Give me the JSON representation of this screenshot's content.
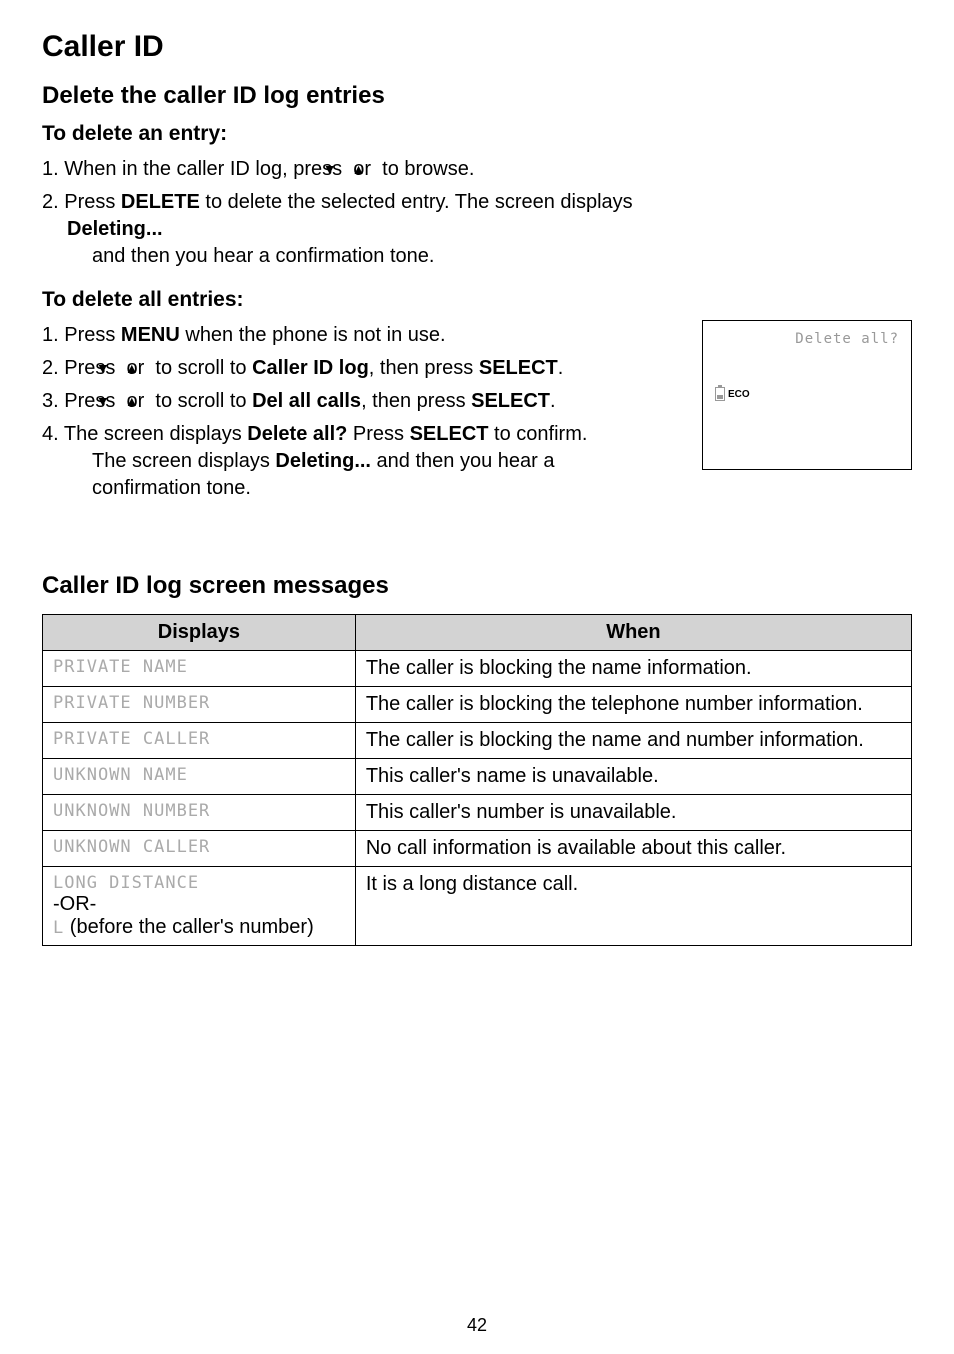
{
  "title": "Caller ID",
  "section1": {
    "heading": "Delete the caller ID log entries",
    "subheading_a": "To delete an entry:",
    "steps_a": {
      "s1_prefix": "1. When in the caller ID log, press ",
      "s1_mid": " or ",
      "s1_suffix": " to browse.",
      "s2_prefix": "2. Press ",
      "s2_bold1": "DELETE",
      "s2_mid": " to delete the selected entry. The screen displays ",
      "s2_bold2": "Deleting...",
      "s2_cont": "and then you hear a confirmation tone."
    },
    "subheading_b": "To delete all entries:",
    "steps_b": {
      "s1_prefix": "1. Press ",
      "s1_bold": "MENU",
      "s1_suffix": " when the phone is not in use.",
      "s2_prefix": "2. Press ",
      "s2_mid1": " or ",
      "s2_mid2": " to scroll to ",
      "s2_bold1": "Caller ID log",
      "s2_mid3": ", then press ",
      "s2_bold2": "SELECT",
      "s2_suffix": ".",
      "s3_prefix": "3. Press ",
      "s3_mid1": " or ",
      "s3_mid2": " to scroll to ",
      "s3_bold1": "Del all calls",
      "s3_mid3": ", then press ",
      "s3_bold2": "SELECT",
      "s3_suffix": ".",
      "s4_prefix": "4. The screen displays ",
      "s4_bold1": "Delete all?",
      "s4_mid1": " Press ",
      "s4_bold2": "SELECT",
      "s4_mid2": " to confirm.",
      "s4_cont1": "The screen displays ",
      "s4_bold3": "Deleting...",
      "s4_cont2": " and then you hear a",
      "s4_cont3": "confirmation tone."
    }
  },
  "screen": {
    "line1": "Delete all?",
    "eco": "ECO"
  },
  "section2": {
    "heading": "Caller ID log screen messages",
    "headers": {
      "displays": "Displays",
      "when": "When"
    },
    "rows": [
      {
        "display": "PRIVATE NAME",
        "when": "The caller is blocking the name information."
      },
      {
        "display": "PRIVATE NUMBER",
        "when": "The caller is blocking the telephone number information."
      },
      {
        "display": "PRIVATE CALLER",
        "when": "The caller is blocking the name and number information."
      },
      {
        "display": "UNKNOWN NAME",
        "when": "This caller's name is unavailable."
      },
      {
        "display": "UNKNOWN NUMBER",
        "when": "This caller's number is unavailable."
      },
      {
        "display": "UNKNOWN CALLER",
        "when": "No call information is available about this caller."
      },
      {
        "display_line1": "LONG DISTANCE",
        "display_line2": "-OR-",
        "display_line3_lcd": "L",
        "display_line3_text": " (before the caller's number)",
        "when": "It is a long distance call."
      }
    ]
  },
  "page_number": "42"
}
